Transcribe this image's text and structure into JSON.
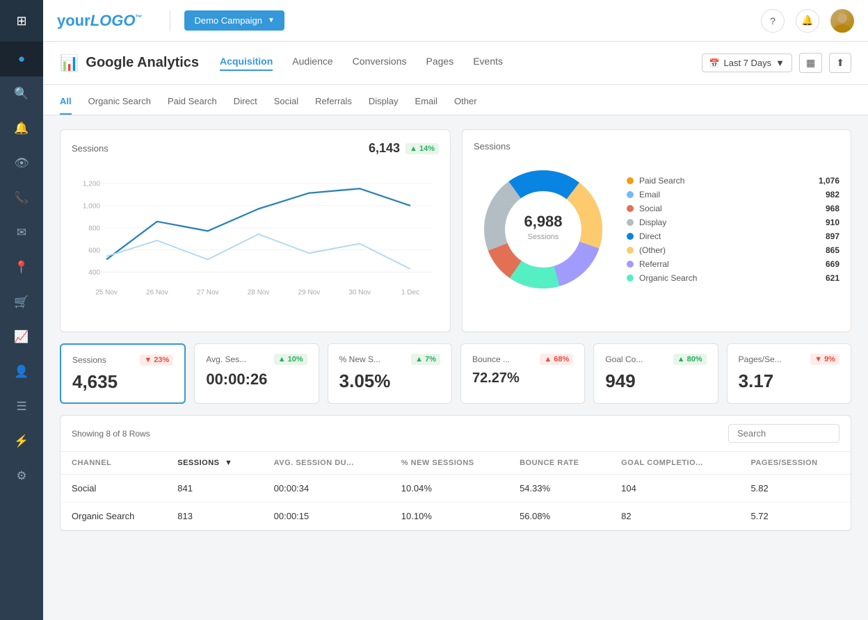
{
  "app": {
    "logo_text": "your",
    "logo_brand": "LOGO",
    "logo_tm": "™"
  },
  "topbar": {
    "campaign_btn": "Demo Campaign",
    "help_icon": "?",
    "bell_icon": "🔔"
  },
  "ga_header": {
    "title": "Google Analytics",
    "icon": "📊",
    "tabs": [
      "Acquisition",
      "Audience",
      "Conversions",
      "Pages",
      "Events"
    ],
    "active_tab": "Acquisition",
    "last_days_btn": "Last 7 Days",
    "grid_icon": "▦",
    "share_icon": "⬆"
  },
  "sub_tabs": {
    "items": [
      "All",
      "Organic Search",
      "Paid Search",
      "Direct",
      "Social",
      "Referrals",
      "Display",
      "Email",
      "Other"
    ],
    "active": "All"
  },
  "line_chart": {
    "title": "Sessions",
    "value": "6,143",
    "badge": "▲ 14%",
    "badge_type": "up",
    "y_labels": [
      "1,200",
      "1,000",
      "800",
      "600",
      "400"
    ],
    "x_labels": [
      "25 Nov",
      "26 Nov",
      "27 Nov",
      "28 Nov",
      "29 Nov",
      "30 Nov",
      "1 Dec"
    ]
  },
  "donut_chart": {
    "title": "Sessions",
    "center_value": "6,988",
    "center_label": "Sessions",
    "legend": [
      {
        "label": "Paid Search",
        "value": "1,076",
        "color": "#f39c12"
      },
      {
        "label": "Email",
        "value": "982",
        "color": "#74b9ff"
      },
      {
        "label": "Social",
        "value": "968",
        "color": "#e17055"
      },
      {
        "label": "Display",
        "value": "910",
        "color": "#b2bec3"
      },
      {
        "label": "Direct",
        "value": "897",
        "color": "#0984e3"
      },
      {
        "label": "(Other)",
        "value": "865",
        "color": "#fdcb6e"
      },
      {
        "label": "Referral",
        "value": "669",
        "color": "#a29bfe"
      },
      {
        "label": "Organic Search",
        "value": "621",
        "color": "#55efc4"
      }
    ]
  },
  "metrics": [
    {
      "label": "Sessions",
      "value": "4,635",
      "badge": "▼ 23%",
      "badge_type": "down"
    },
    {
      "label": "Avg. Ses...",
      "value": "00:00:26",
      "badge": "▲ 10%",
      "badge_type": "up"
    },
    {
      "label": "% New S...",
      "value": "3.05%",
      "badge": "▲ 7%",
      "badge_type": "up"
    },
    {
      "label": "Bounce ...",
      "value": "72.27%",
      "badge": "▲ 68%",
      "badge_type": "down"
    },
    {
      "label": "Goal Co...",
      "value": "949",
      "badge": "▲ 80%",
      "badge_type": "up"
    },
    {
      "label": "Pages/Se...",
      "value": "3.17",
      "badge": "▼ 9%",
      "badge_type": "down"
    }
  ],
  "table": {
    "row_count": "Showing 8 of 8 Rows",
    "search_placeholder": "Search",
    "columns": [
      "CHANNEL",
      "SESSIONS",
      "AVG. SESSION DU...",
      "% NEW SESSIONS",
      "BOUNCE RATE",
      "GOAL COMPLETIO...",
      "PAGES/SESSION"
    ],
    "rows": [
      {
        "channel": "Social",
        "sessions": "841",
        "avg_dur": "00:00:34",
        "new_sessions": "10.04%",
        "bounce": "54.33%",
        "goal": "104",
        "pages": "5.82"
      },
      {
        "channel": "Organic Search",
        "sessions": "813",
        "avg_dur": "00:00:15",
        "new_sessions": "10.10%",
        "bounce": "56.08%",
        "goal": "82",
        "pages": "5.72"
      }
    ]
  },
  "sidebar_icons": [
    "⊞",
    "📊",
    "🔍",
    "🔔",
    "👁",
    "📞",
    "✉",
    "📍",
    "🛒",
    "📈",
    "👤",
    "☰",
    "⚡",
    "⚙"
  ]
}
